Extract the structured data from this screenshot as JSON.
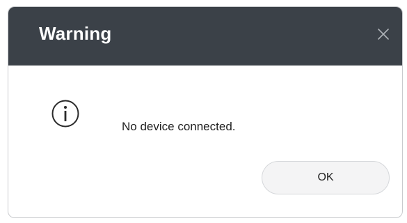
{
  "dialog": {
    "title": "Warning",
    "message": "No device connected.",
    "ok_label": "OK",
    "icons": {
      "close": "close-icon",
      "info": "info-icon"
    },
    "colors": {
      "titlebar": "#3b4148",
      "title_text": "#ffffff",
      "button_bg": "#f4f4f5"
    }
  }
}
